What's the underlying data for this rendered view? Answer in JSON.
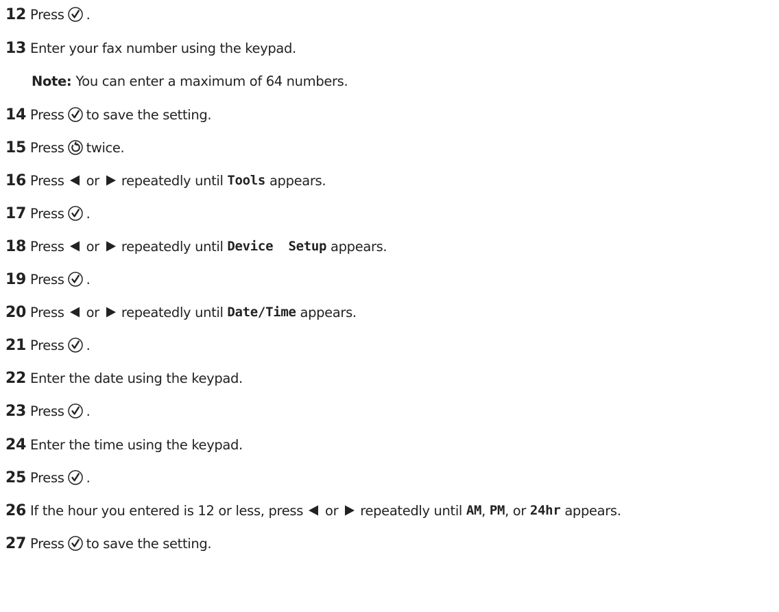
{
  "words": {
    "press": "Press",
    "or": "or",
    "repeatedly_until": "repeatedly until",
    "appears": "appears.",
    "period": ".",
    "to_save": "to save the setting.",
    "twice": "twice."
  },
  "steps": {
    "s12": {
      "num": "12"
    },
    "s13": {
      "num": "13",
      "text": "Enter your fax number using the keypad."
    },
    "note": {
      "label": "Note:",
      "text": "You can enter a maximum of 64 numbers."
    },
    "s14": {
      "num": "14"
    },
    "s15": {
      "num": "15"
    },
    "s16": {
      "num": "16",
      "code": "Tools"
    },
    "s17": {
      "num": "17"
    },
    "s18": {
      "num": "18",
      "code": "Device  Setup"
    },
    "s19": {
      "num": "19"
    },
    "s20": {
      "num": "20",
      "code": "Date/Time"
    },
    "s21": {
      "num": "21"
    },
    "s22": {
      "num": "22",
      "text": "Enter the date using the keypad."
    },
    "s23": {
      "num": "23"
    },
    "s24": {
      "num": "24",
      "text": "Enter the time using the keypad."
    },
    "s25": {
      "num": "25"
    },
    "s26": {
      "num": "26",
      "text_before": "If the hour you entered is 12 or less, press",
      "code_am": "AM",
      "comma": ",",
      "code_pm": "PM",
      "comma_or": ", or",
      "code_24hr": "24hr"
    },
    "s27": {
      "num": "27"
    }
  },
  "icons": {
    "select": "checkmark-circle-icon",
    "back": "back-arrow-circle-icon",
    "left": "left-arrow-icon",
    "right": "right-arrow-icon"
  }
}
